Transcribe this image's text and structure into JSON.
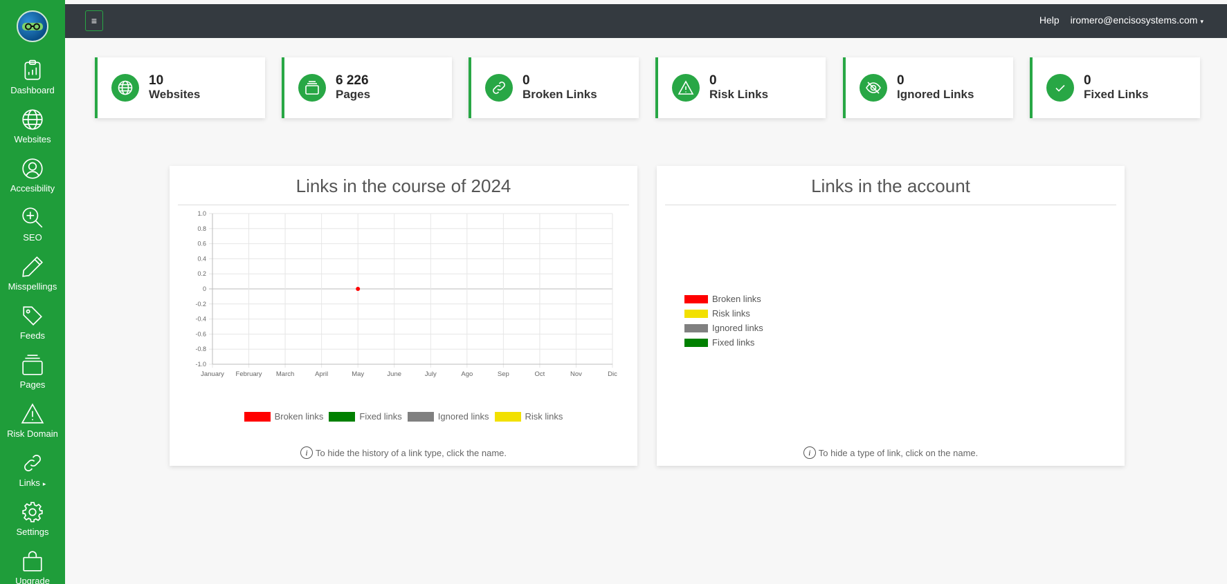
{
  "sidebar": {
    "items": [
      {
        "label": "Dashboard",
        "icon": "dashboard-icon"
      },
      {
        "label": "Websites",
        "icon": "globe-icon"
      },
      {
        "label": "Accesibility",
        "icon": "user-circle-icon"
      },
      {
        "label": "SEO",
        "icon": "zoom-in-icon"
      },
      {
        "label": "Misspellings",
        "icon": "pencil-icon"
      },
      {
        "label": "Feeds",
        "icon": "tag-icon"
      },
      {
        "label": "Pages",
        "icon": "collection-icon"
      },
      {
        "label": "Risk Domain",
        "icon": "warning-icon"
      },
      {
        "label": "Links",
        "icon": "link-icon"
      },
      {
        "label": "Settings",
        "icon": "gear-icon"
      },
      {
        "label": "Upgrade",
        "icon": "bag-icon"
      }
    ],
    "links_caret": "▸"
  },
  "topbar": {
    "menu_glyph": "≡",
    "help": "Help",
    "user": "iromero@encisosystems.com",
    "caret": "▾"
  },
  "stats": [
    {
      "value": "10",
      "label": "Websites",
      "icon": "globe-icon"
    },
    {
      "value": "6 226",
      "label": "Pages",
      "icon": "collection-icon"
    },
    {
      "value": "0",
      "label": "Broken Links",
      "icon": "link-icon"
    },
    {
      "value": "0",
      "label": "Risk Links",
      "icon": "warning-icon"
    },
    {
      "value": "0",
      "label": "Ignored Links",
      "icon": "eye-slash-icon"
    },
    {
      "value": "0",
      "label": "Fixed Links",
      "icon": "check-icon"
    }
  ],
  "history_panel": {
    "title": "Links in the course of 2024",
    "note": "To hide the history of a link type, click the name.",
    "info_glyph": "i"
  },
  "account_panel": {
    "title": "Links in the account",
    "note": "To hide a type of link, click on the name.",
    "info_glyph": "i",
    "legend": [
      {
        "name": "Broken links",
        "color": "#ff0000"
      },
      {
        "name": "Risk links",
        "color": "#f2e000"
      },
      {
        "name": "Ignored links",
        "color": "#808080"
      },
      {
        "name": "Fixed links",
        "color": "#008000"
      }
    ]
  },
  "colors": {
    "sidebar": "#1f9d3a",
    "accent": "#28a745",
    "topbar": "#343a40"
  },
  "chart_data": {
    "type": "line",
    "categories": [
      "January",
      "February",
      "March",
      "April",
      "May",
      "June",
      "July",
      "Ago",
      "Sep",
      "Oct",
      "Nov",
      "Dic"
    ],
    "yticks": [
      "1.0",
      "0.8",
      "0.6",
      "0.4",
      "0.2",
      "0",
      "-0.2",
      "-0.4",
      "-0.6",
      "-0.8",
      "-1.0"
    ],
    "ylim": [
      -1.0,
      1.0
    ],
    "grid": true,
    "legend_position": "bottom",
    "series": [
      {
        "name": "Broken links",
        "color": "#ff0000",
        "points": [
          {
            "x": "May",
            "y": 0
          }
        ]
      },
      {
        "name": "Fixed links",
        "color": "#008000",
        "points": []
      },
      {
        "name": "Ignored links",
        "color": "#808080",
        "points": []
      },
      {
        "name": "Risk links",
        "color": "#f2e000",
        "points": []
      }
    ]
  }
}
